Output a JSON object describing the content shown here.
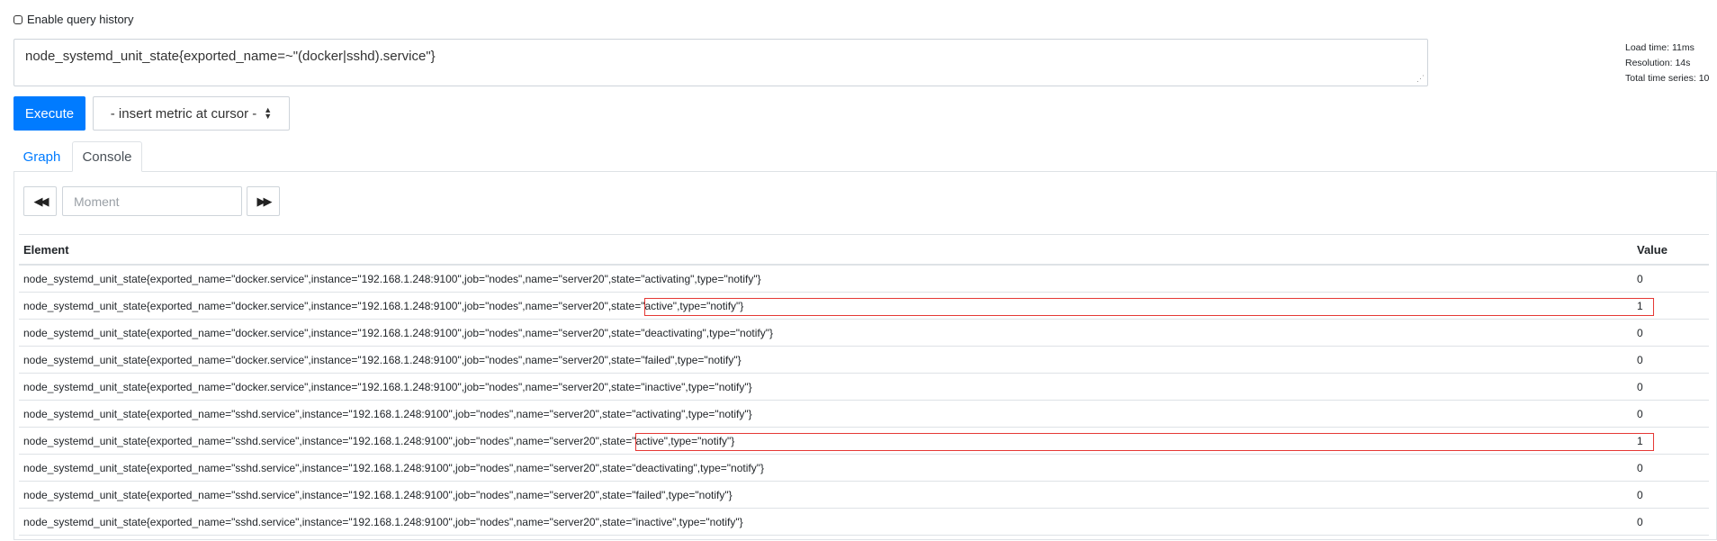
{
  "history": {
    "label": "Enable query history"
  },
  "query": {
    "expression": "node_systemd_unit_state{exported_name=~\"(docker|sshd).service\"}"
  },
  "stats": {
    "load_time": "Load time: 11ms",
    "resolution": "Resolution: 14s",
    "total_series": "Total time series: 10"
  },
  "controls": {
    "execute_label": "Execute",
    "metric_select": "- insert metric at cursor -"
  },
  "tabs": [
    {
      "label": "Graph",
      "active": false
    },
    {
      "label": "Console",
      "active": true
    }
  ],
  "console": {
    "moment_placeholder": "Moment",
    "columns": {
      "element": "Element",
      "value": "Value"
    },
    "rows": [
      {
        "element": "node_systemd_unit_state{exported_name=\"docker.service\",instance=\"192.168.1.248:9100\",job=\"nodes\",name=\"server20\",state=\"activating\",type=\"notify\"}",
        "value": "0",
        "highlighted": false
      },
      {
        "element": "node_systemd_unit_state{exported_name=\"docker.service\",instance=\"192.168.1.248:9100\",job=\"nodes\",name=\"server20\",state=\"active\",type=\"notify\"}",
        "value": "1",
        "highlighted": true
      },
      {
        "element": "node_systemd_unit_state{exported_name=\"docker.service\",instance=\"192.168.1.248:9100\",job=\"nodes\",name=\"server20\",state=\"deactivating\",type=\"notify\"}",
        "value": "0",
        "highlighted": false
      },
      {
        "element": "node_systemd_unit_state{exported_name=\"docker.service\",instance=\"192.168.1.248:9100\",job=\"nodes\",name=\"server20\",state=\"failed\",type=\"notify\"}",
        "value": "0",
        "highlighted": false
      },
      {
        "element": "node_systemd_unit_state{exported_name=\"docker.service\",instance=\"192.168.1.248:9100\",job=\"nodes\",name=\"server20\",state=\"inactive\",type=\"notify\"}",
        "value": "0",
        "highlighted": false
      },
      {
        "element": "node_systemd_unit_state{exported_name=\"sshd.service\",instance=\"192.168.1.248:9100\",job=\"nodes\",name=\"server20\",state=\"activating\",type=\"notify\"}",
        "value": "0",
        "highlighted": false
      },
      {
        "element": "node_systemd_unit_state{exported_name=\"sshd.service\",instance=\"192.168.1.248:9100\",job=\"nodes\",name=\"server20\",state=\"active\",type=\"notify\"}",
        "value": "1",
        "highlighted": true
      },
      {
        "element": "node_systemd_unit_state{exported_name=\"sshd.service\",instance=\"192.168.1.248:9100\",job=\"nodes\",name=\"server20\",state=\"deactivating\",type=\"notify\"}",
        "value": "0",
        "highlighted": false
      },
      {
        "element": "node_systemd_unit_state{exported_name=\"sshd.service\",instance=\"192.168.1.248:9100\",job=\"nodes\",name=\"server20\",state=\"failed\",type=\"notify\"}",
        "value": "0",
        "highlighted": false
      },
      {
        "element": "node_systemd_unit_state{exported_name=\"sshd.service\",instance=\"192.168.1.248:9100\",job=\"nodes\",name=\"server20\",state=\"inactive\",type=\"notify\"}",
        "value": "0",
        "highlighted": false
      }
    ]
  },
  "colors": {
    "accent": "#007bff",
    "highlight": "#e53935"
  },
  "icons": {
    "checkbox": "checkbox-icon",
    "select_arrows": "sort-arrows-icon",
    "back": "backward-icon",
    "forward": "forward-icon",
    "resize": "resize-grip-icon"
  }
}
